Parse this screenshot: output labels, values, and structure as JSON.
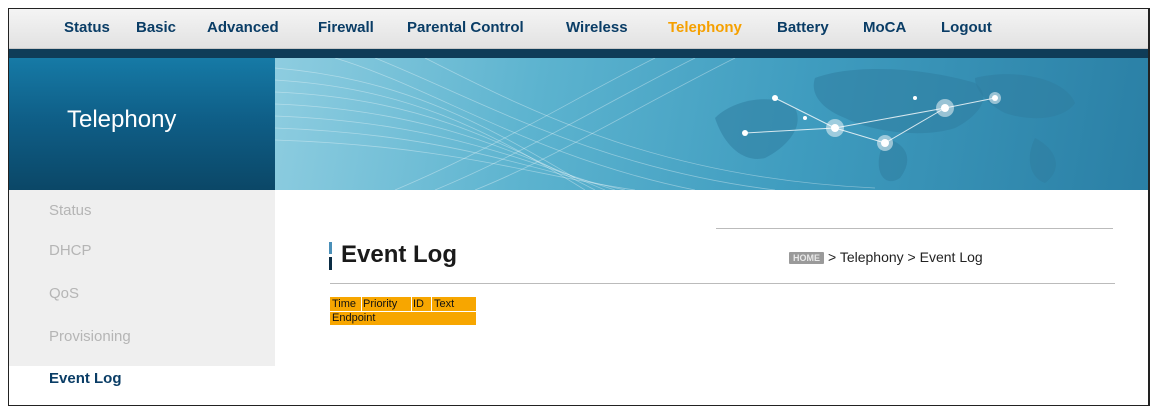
{
  "topnav": {
    "items": [
      {
        "label": "Status"
      },
      {
        "label": "Basic"
      },
      {
        "label": "Advanced"
      },
      {
        "label": "Firewall"
      },
      {
        "label": "Parental Control"
      },
      {
        "label": "Wireless"
      },
      {
        "label": "Telephony"
      },
      {
        "label": "Battery"
      },
      {
        "label": "MoCA"
      },
      {
        "label": "Logout"
      }
    ],
    "active": "Telephony"
  },
  "banner": {
    "section_title": "Telephony"
  },
  "sidebar": {
    "items": [
      {
        "label": "Status"
      },
      {
        "label": "DHCP"
      },
      {
        "label": "QoS"
      },
      {
        "label": "Provisioning"
      },
      {
        "label": "Event Log"
      }
    ],
    "active": "Event Log"
  },
  "page": {
    "title": "Event Log",
    "breadcrumb": {
      "home": "HOME",
      "section": "Telephony",
      "current": "Event Log",
      "separator": ">"
    }
  },
  "event_log": {
    "columns": [
      "Time",
      "Priority",
      "ID",
      "Text"
    ],
    "sub_header": "Endpoint",
    "rows": []
  },
  "colors": {
    "nav_text": "#0a3d66",
    "active_accent": "#f5a000",
    "table_header": "#f7a600",
    "banner_dark": "#0f3c58"
  }
}
